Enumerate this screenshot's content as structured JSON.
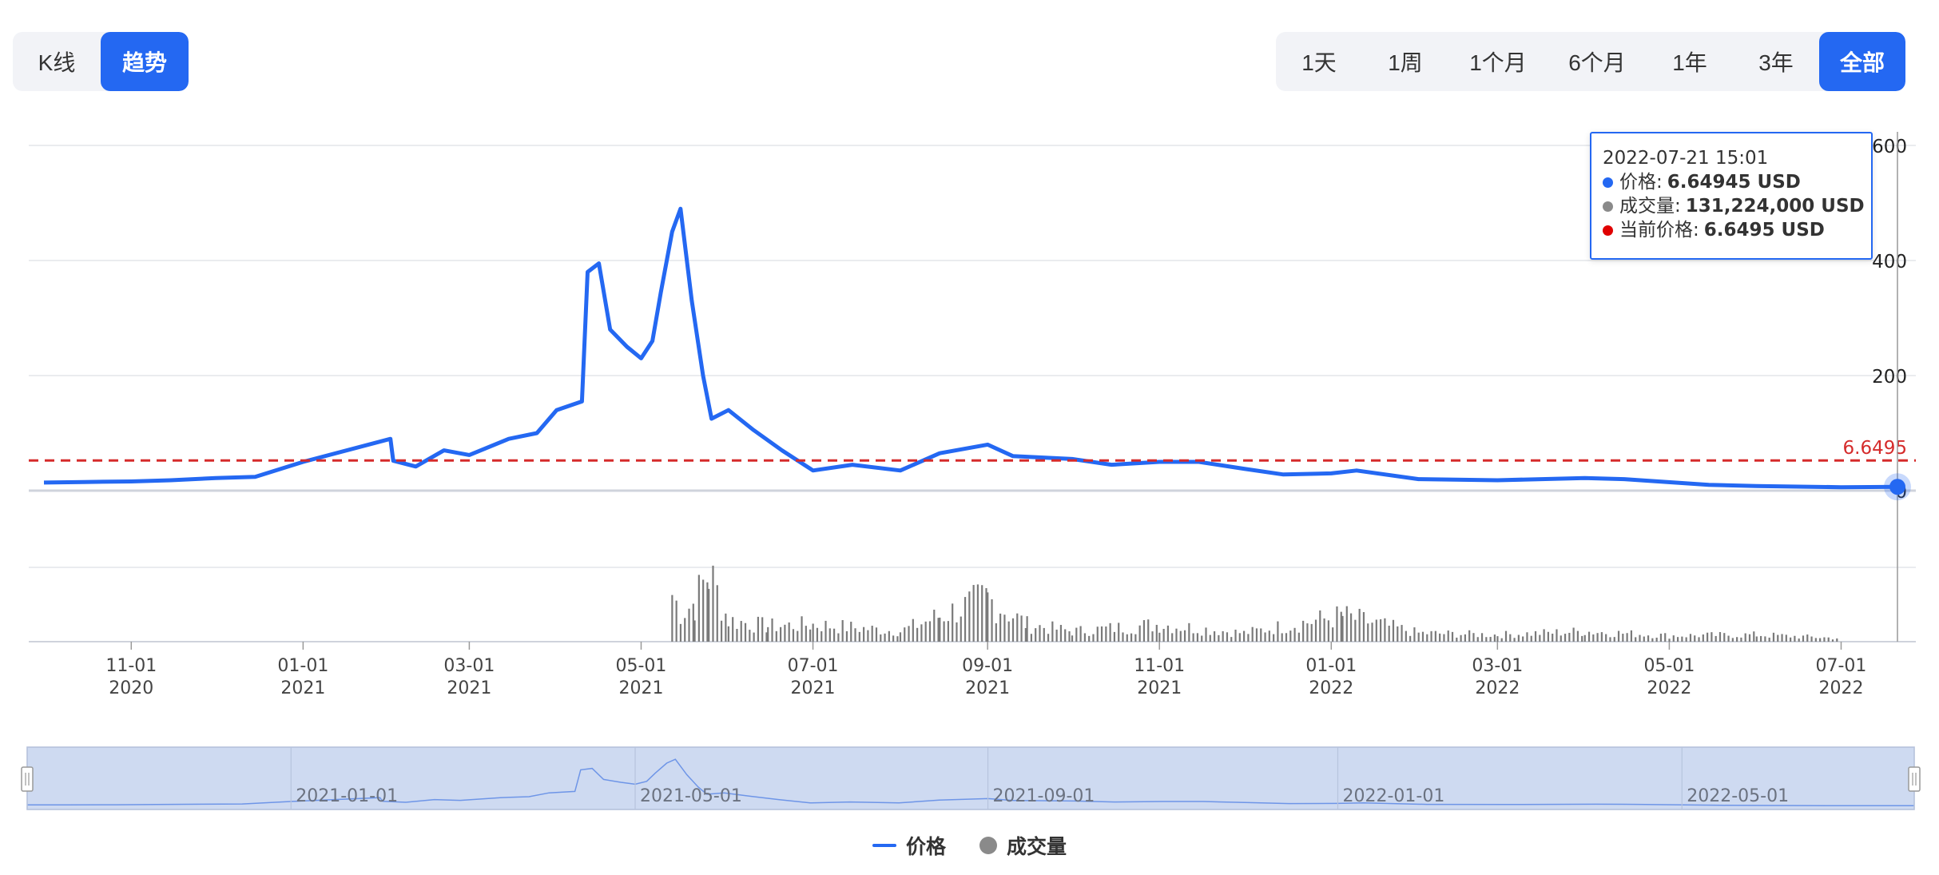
{
  "mode_toggle": {
    "kline_label": "K线",
    "trend_label": "趋势",
    "active": "trend"
  },
  "range_toggle": {
    "items": [
      "1天",
      "1周",
      "1个月",
      "6个月",
      "1年",
      "3年",
      "全部"
    ],
    "active_index": 6
  },
  "tooltip": {
    "datetime": "2022-07-21 15:01",
    "price_label": "价格:",
    "price_value": "6.64945 USD",
    "volume_label": "成交量:",
    "volume_value": "131,224,000 USD",
    "current_label": "当前价格:",
    "current_value": "6.6495 USD"
  },
  "legend": {
    "price": "价格",
    "volume": "成交量"
  },
  "colors": {
    "price": "#2468f2",
    "volume": "#8a8a8a",
    "current": "#d52b2b",
    "accent": "#2468f2"
  },
  "chart_data": {
    "type": "line",
    "start_date": "2020-10-01",
    "end_date": "2022-07-21",
    "x_ticks": [
      {
        "date": "2020-11-01",
        "label": [
          "11-01",
          "2020"
        ]
      },
      {
        "date": "2021-01-01",
        "label": [
          "01-01",
          "2021"
        ]
      },
      {
        "date": "2021-03-01",
        "label": [
          "03-01",
          "2021"
        ]
      },
      {
        "date": "2021-05-01",
        "label": [
          "05-01",
          "2021"
        ]
      },
      {
        "date": "2021-07-01",
        "label": [
          "07-01",
          "2021"
        ]
      },
      {
        "date": "2021-09-01",
        "label": [
          "09-01",
          "2021"
        ]
      },
      {
        "date": "2021-11-01",
        "label": [
          "11-01",
          "2021"
        ]
      },
      {
        "date": "2022-01-01",
        "label": [
          "01-01",
          "2022"
        ]
      },
      {
        "date": "2022-03-01",
        "label": [
          "03-01",
          "2022"
        ]
      },
      {
        "date": "2022-05-01",
        "label": [
          "05-01",
          "2022"
        ]
      },
      {
        "date": "2022-07-01",
        "label": [
          "07-01",
          "2022"
        ]
      }
    ],
    "y_ticks": [
      0,
      200,
      400,
      600
    ],
    "ylim": [
      0,
      600
    ],
    "current_price": 6.6495,
    "current_price_label": "6.6495",
    "series": [
      {
        "name": "价格",
        "points": [
          [
            "2020-10-01",
            14
          ],
          [
            "2020-10-15",
            15
          ],
          [
            "2020-11-01",
            16
          ],
          [
            "2020-11-15",
            18
          ],
          [
            "2020-12-01",
            22
          ],
          [
            "2020-12-15",
            24
          ],
          [
            "2021-01-01",
            50
          ],
          [
            "2021-02-01",
            90
          ],
          [
            "2021-02-02",
            52
          ],
          [
            "2021-02-10",
            42
          ],
          [
            "2021-02-20",
            70
          ],
          [
            "2021-03-01",
            62
          ],
          [
            "2021-03-15",
            90
          ],
          [
            "2021-03-25",
            100
          ],
          [
            "2021-04-01",
            140
          ],
          [
            "2021-04-10",
            155
          ],
          [
            "2021-04-12",
            380
          ],
          [
            "2021-04-16",
            395
          ],
          [
            "2021-04-20",
            280
          ],
          [
            "2021-04-26",
            250
          ],
          [
            "2021-05-01",
            230
          ],
          [
            "2021-05-05",
            260
          ],
          [
            "2021-05-08",
            345
          ],
          [
            "2021-05-12",
            450
          ],
          [
            "2021-05-15",
            490
          ],
          [
            "2021-05-19",
            330
          ],
          [
            "2021-05-23",
            200
          ],
          [
            "2021-05-26",
            125
          ],
          [
            "2021-06-01",
            140
          ],
          [
            "2021-06-10",
            105
          ],
          [
            "2021-06-20",
            70
          ],
          [
            "2021-07-01",
            35
          ],
          [
            "2021-07-15",
            45
          ],
          [
            "2021-08-01",
            35
          ],
          [
            "2021-08-15",
            65
          ],
          [
            "2021-09-01",
            80
          ],
          [
            "2021-09-10",
            60
          ],
          [
            "2021-10-01",
            55
          ],
          [
            "2021-10-15",
            45
          ],
          [
            "2021-11-01",
            50
          ],
          [
            "2021-11-15",
            50
          ],
          [
            "2021-12-01",
            38
          ],
          [
            "2021-12-15",
            28
          ],
          [
            "2022-01-01",
            30
          ],
          [
            "2022-01-10",
            35
          ],
          [
            "2022-02-01",
            20
          ],
          [
            "2022-03-01",
            18
          ],
          [
            "2022-04-01",
            22
          ],
          [
            "2022-04-15",
            20
          ],
          [
            "2022-05-15",
            10
          ],
          [
            "2022-06-01",
            8
          ],
          [
            "2022-07-01",
            6
          ],
          [
            "2022-07-21",
            6.64945
          ]
        ]
      },
      {
        "name": "成交量",
        "points": [
          [
            "2021-05-12",
            0.55
          ],
          [
            "2021-05-15",
            0.35
          ],
          [
            "2021-05-20",
            0.45
          ],
          [
            "2021-05-25",
            0.8
          ],
          [
            "2021-06-01",
            0.25
          ],
          [
            "2021-06-15",
            0.18
          ],
          [
            "2021-07-01",
            0.2
          ],
          [
            "2021-08-01",
            0.12
          ],
          [
            "2021-08-15",
            0.3
          ],
          [
            "2021-09-01",
            0.5
          ],
          [
            "2021-09-15",
            0.2
          ],
          [
            "2021-10-01",
            0.12
          ],
          [
            "2021-11-01",
            0.2
          ],
          [
            "2021-12-01",
            0.1
          ],
          [
            "2022-01-05",
            0.3
          ],
          [
            "2022-02-01",
            0.1
          ],
          [
            "2022-03-01",
            0.08
          ],
          [
            "2022-04-01",
            0.12
          ],
          [
            "2022-05-01",
            0.07
          ],
          [
            "2022-06-01",
            0.08
          ],
          [
            "2022-07-01",
            0.04
          ]
        ]
      }
    ],
    "navigator": {
      "labels": [
        "2021-01-01",
        "2021-05-01",
        "2021-09-01",
        "2022-01-01",
        "2022-05-01"
      ],
      "selection": [
        "2020-10-01",
        "2022-07-21"
      ]
    }
  }
}
